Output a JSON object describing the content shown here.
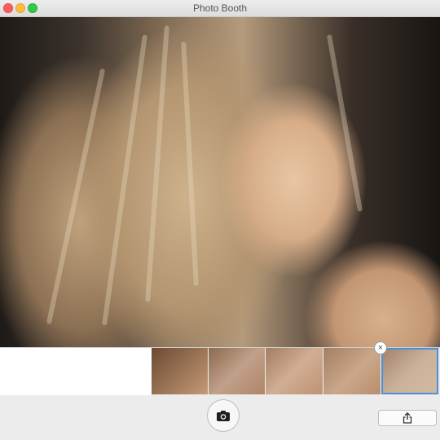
{
  "window": {
    "title": "Photo Booth",
    "controls": [
      "close",
      "minimize",
      "zoom"
    ]
  },
  "viewport": {
    "content": "live-camera-preview"
  },
  "strip": {
    "thumbnails": [
      {
        "index": 1,
        "selected": false
      },
      {
        "index": 2,
        "selected": false
      },
      {
        "index": 3,
        "selected": false
      },
      {
        "index": 4,
        "selected": false
      },
      {
        "index": 5,
        "selected": true
      }
    ],
    "delete_glyph": "×"
  },
  "toolbar": {
    "shutter_icon": "camera-icon",
    "share_icon": "share-icon"
  },
  "colors": {
    "close": "#fc605c",
    "minimize": "#fdbc40",
    "zoom": "#34c84a",
    "selection": "#4a90d9"
  }
}
